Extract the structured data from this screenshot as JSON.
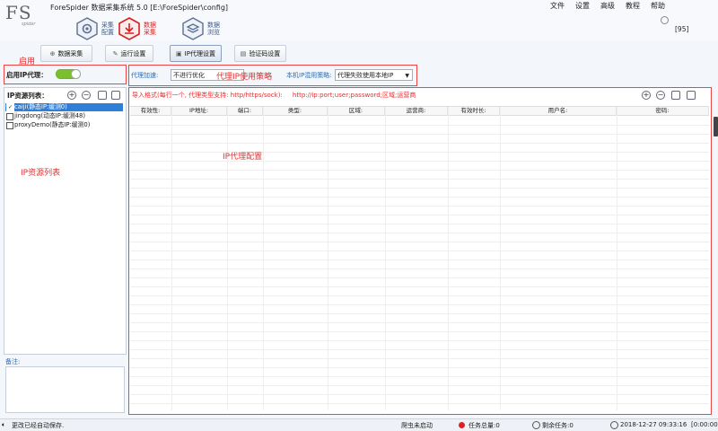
{
  "app": {
    "logo": "FS",
    "logo_sub": "spider",
    "title": "ForeSpider 数据采集系统  5.0  [E:\\ForeSpider\\config]",
    "menu": [
      "文件",
      "设置",
      "高级",
      "教程",
      "帮助"
    ],
    "counter": "[95]"
  },
  "nav": [
    {
      "label": "采集\n配置"
    },
    {
      "label": "数据\n采集"
    },
    {
      "label": "数据\n浏览"
    }
  ],
  "toolbar": {
    "collect_label": "数据采集",
    "run_label": "运行设置",
    "proxy_label": "IP代理设置",
    "captcha_label": "验证码设置"
  },
  "enable": {
    "annotation": "启用",
    "label": "启用IP代理："
  },
  "proxy_settings": {
    "accel_label": "代理加速:",
    "accel_value": "不进行优化",
    "annotation": "代理IP使用策略",
    "local_label": "本机IP混用策略:",
    "local_value": "代理失败使用本地IP"
  },
  "ip_list": {
    "header": "IP资源列表：",
    "items": [
      {
        "label": "caiji(静态IP:缓测0)",
        "checked": true
      },
      {
        "label": "jingdong(动态IP:缓测48)",
        "checked": false
      },
      {
        "label": "proxyDemo(静态IP:缓测0)",
        "checked": false
      }
    ],
    "annotation": "IP资源列表",
    "notes_label": "备注:"
  },
  "config": {
    "import_hint": "导入格式(每行一个, 代理类型支持: http/https/sock):     http://ip:port;user;password;区域;运营商",
    "annotation": "IP代理配置",
    "columns": [
      "有效性:",
      "IP地址:",
      "端口:",
      "类型:",
      "区域:",
      "运营商:",
      "有效时长:",
      "用户名:",
      "密码:"
    ]
  },
  "status": {
    "autosave": "更改已经自动保存.",
    "crawler": "爬虫未启动",
    "total": "任务总量:0",
    "remaining": "剩余任务:0",
    "datetime": "2018-12-27  09:33:16",
    "elapsed": "[0:00:00"
  },
  "colors": {
    "accent_red": "#e03030",
    "nav_blue": "#3a5a8a",
    "toggle_green": "#7bbf2c"
  }
}
